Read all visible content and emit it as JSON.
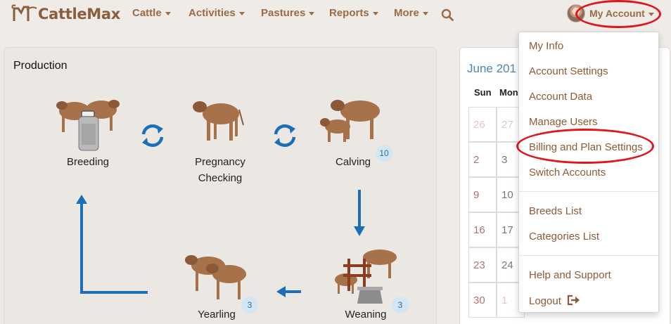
{
  "brand": {
    "name": "CattleMax"
  },
  "nav": {
    "items": [
      {
        "label": "Cattle"
      },
      {
        "label": "Activities"
      },
      {
        "label": "Pastures"
      },
      {
        "label": "Reports"
      },
      {
        "label": "More"
      }
    ],
    "account_label": "My Account"
  },
  "production": {
    "title": "Production",
    "stages": [
      {
        "label": "Breeding"
      },
      {
        "label": "Pregnancy Checking"
      },
      {
        "label": "Calving",
        "badge": "10"
      },
      {
        "label": "Weaning",
        "badge": "3"
      },
      {
        "label": "Yearling",
        "badge": "3"
      }
    ]
  },
  "calendar": {
    "month_label": "June 201",
    "weekdays": [
      "Sun",
      "Mon"
    ],
    "rows": [
      [
        "26",
        "27"
      ],
      [
        "2",
        "3"
      ],
      [
        "9",
        "10"
      ],
      [
        "16",
        "17"
      ],
      [
        "23",
        "24"
      ],
      [
        "30",
        "1"
      ]
    ]
  },
  "account_menu": {
    "groups": [
      [
        "My Info",
        "Account Settings",
        "Account Data",
        "Manage Users",
        "Billing and Plan Settings",
        "Switch Accounts"
      ],
      [
        "Breeds List",
        "Categories List"
      ],
      [
        "Help and Support",
        "Logout"
      ]
    ]
  },
  "colors": {
    "brand_brown": "#9c6b45",
    "link_brown": "#8d5a35",
    "flow_blue": "#1b6fb8",
    "annotation_red": "#e0161e",
    "badge_bg": "#d3e6f3"
  },
  "icons": [
    "search-icon",
    "cycle-arrows-icon",
    "arrow-down-icon",
    "arrow-left-icon",
    "elbow-arrow-up-icon",
    "logout-icon",
    "caret-down-icon"
  ]
}
